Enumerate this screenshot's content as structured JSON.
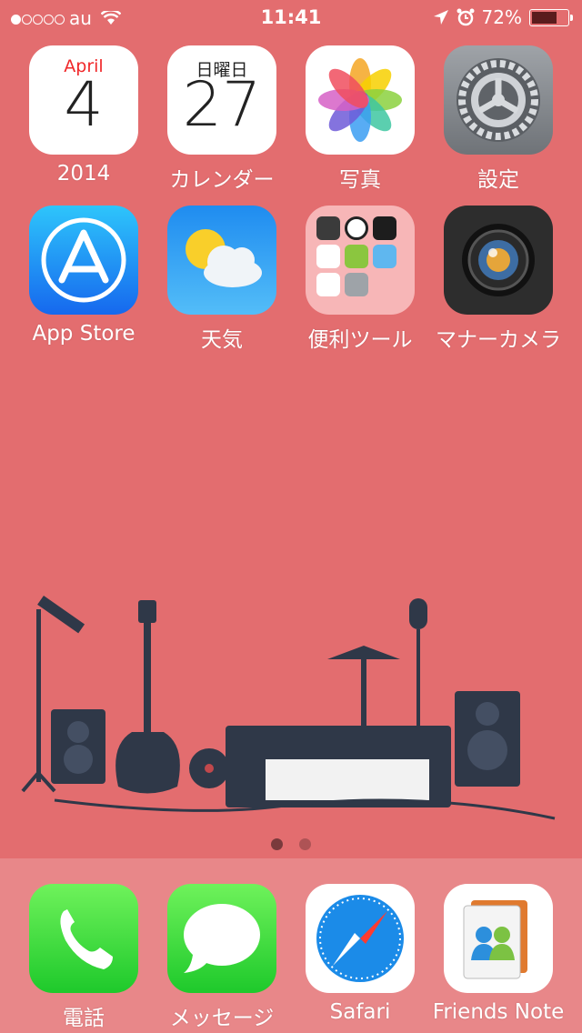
{
  "status_bar": {
    "carrier": "au",
    "time": "11:41",
    "battery": "72%",
    "battery_level": 0.72,
    "signal_bars": 1
  },
  "apps": [
    {
      "name": "2014",
      "icon": "calendar-april-icon",
      "top_text": "April",
      "big_text": "4"
    },
    {
      "name": "カレンダー",
      "icon": "calendar-icon",
      "top_text": "日曜日",
      "big_text": "27"
    },
    {
      "name": "写真",
      "icon": "photos-icon"
    },
    {
      "name": "設定",
      "icon": "settings-gear-icon"
    },
    {
      "name": "App Store",
      "icon": "app-store-icon"
    },
    {
      "name": "天気",
      "icon": "weather-icon"
    },
    {
      "name": "便利ツール",
      "icon": "folder-icon"
    },
    {
      "name": "マナーカメラ",
      "icon": "camera-lens-icon"
    }
  ],
  "page_dots": {
    "count": 2,
    "active": 0
  },
  "dock": [
    {
      "name": "電話",
      "icon": "phone-icon"
    },
    {
      "name": "メッセージ",
      "icon": "messages-icon"
    },
    {
      "name": "Safari",
      "icon": "safari-compass-icon"
    },
    {
      "name": "Friends Note",
      "icon": "friends-note-icon"
    }
  ],
  "colors": {
    "background": "#e36d6f",
    "dock": "#f19c9d"
  }
}
